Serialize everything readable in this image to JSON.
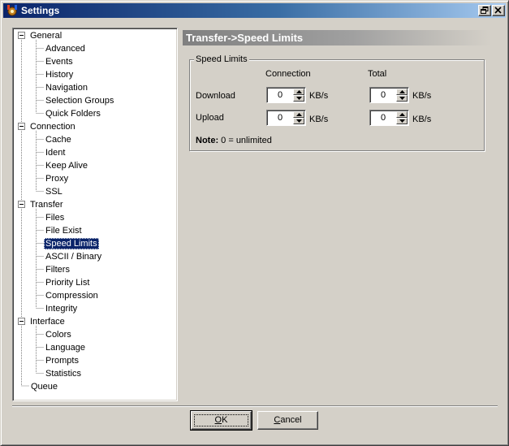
{
  "window": {
    "title": "Settings",
    "icon": "settings-app-icon",
    "controls": [
      "restore-icon",
      "close-icon"
    ]
  },
  "tree": {
    "groups": [
      {
        "label": "General",
        "children": [
          "Advanced",
          "Events",
          "History",
          "Navigation",
          "Selection Groups",
          "Quick Folders"
        ]
      },
      {
        "label": "Connection",
        "children": [
          "Cache",
          "Ident",
          "Keep Alive",
          "Proxy",
          "SSL"
        ]
      },
      {
        "label": "Transfer",
        "children": [
          "Files",
          "File Exist",
          "Speed Limits",
          "ASCII / Binary",
          "Filters",
          "Priority List",
          "Compression",
          "Integrity"
        ]
      },
      {
        "label": "Interface",
        "children": [
          "Colors",
          "Language",
          "Prompts",
          "Statistics"
        ]
      },
      {
        "label": "Queue",
        "children": []
      }
    ],
    "selected": "Speed Limits"
  },
  "panel": {
    "header": "Transfer->Speed Limits",
    "group_title": "Speed Limits",
    "col_connection": "Connection",
    "col_total": "Total",
    "row_download": "Download",
    "row_upload": "Upload",
    "unit": "KB/s",
    "fields": {
      "download_connection": "0",
      "download_total": "0",
      "upload_connection": "0",
      "upload_total": "0"
    },
    "note_bold": "Note:",
    "note_text": " 0 = unlimited"
  },
  "buttons": {
    "ok_mnemonic": "O",
    "ok_rest": "K",
    "cancel_mnemonic": "C",
    "cancel_rest": "ancel"
  }
}
